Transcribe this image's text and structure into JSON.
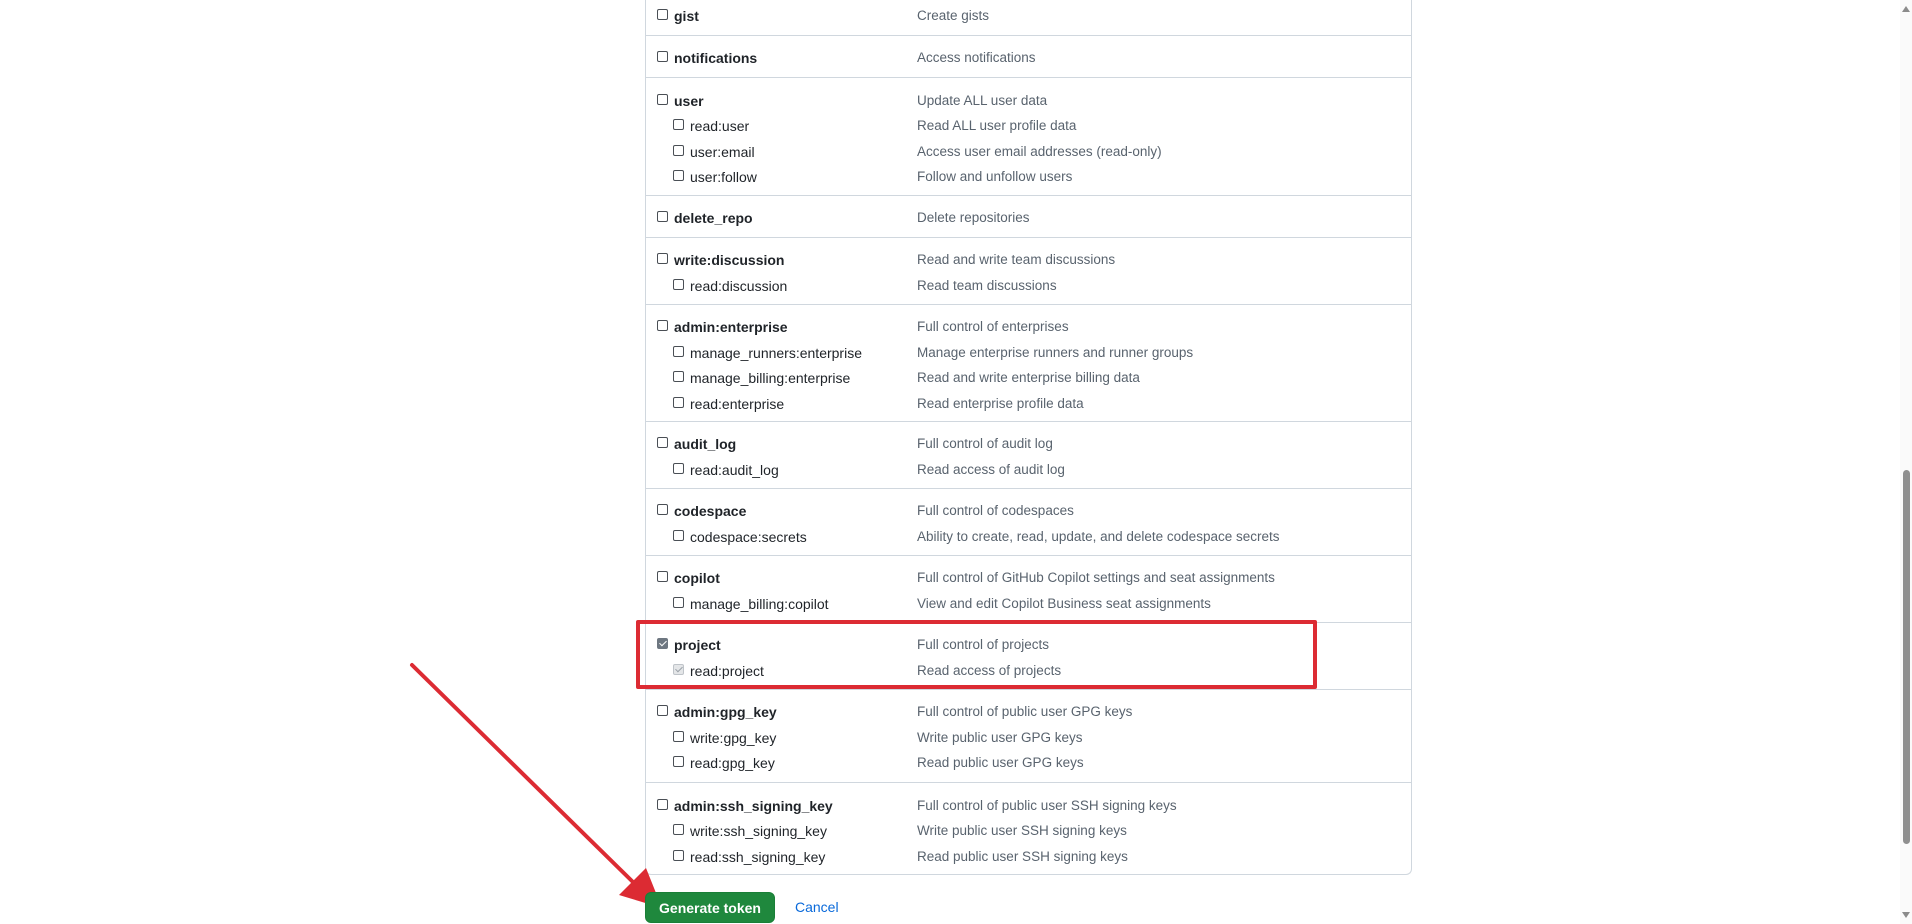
{
  "scopes": [
    {
      "items": [
        {
          "name": "gist",
          "desc": "Create gists",
          "checked": false
        }
      ]
    },
    {
      "items": [
        {
          "name": "notifications",
          "desc": "Access notifications",
          "checked": false
        }
      ]
    },
    {
      "items": [
        {
          "name": "user",
          "desc": "Update ALL user data",
          "checked": false
        },
        {
          "name": "read:user",
          "desc": "Read ALL user profile data",
          "checked": false
        },
        {
          "name": "user:email",
          "desc": "Access user email addresses (read-only)",
          "checked": false
        },
        {
          "name": "user:follow",
          "desc": "Follow and unfollow users",
          "checked": false
        }
      ]
    },
    {
      "items": [
        {
          "name": "delete_repo",
          "desc": "Delete repositories",
          "checked": false
        }
      ]
    },
    {
      "items": [
        {
          "name": "write:discussion",
          "desc": "Read and write team discussions",
          "checked": false
        },
        {
          "name": "read:discussion",
          "desc": "Read team discussions",
          "checked": false
        }
      ]
    },
    {
      "items": [
        {
          "name": "admin:enterprise",
          "desc": "Full control of enterprises",
          "checked": false
        },
        {
          "name": "manage_runners:enterprise",
          "desc": "Manage enterprise runners and runner groups",
          "checked": false
        },
        {
          "name": "manage_billing:enterprise",
          "desc": "Read and write enterprise billing data",
          "checked": false
        },
        {
          "name": "read:enterprise",
          "desc": "Read enterprise profile data",
          "checked": false
        }
      ]
    },
    {
      "items": [
        {
          "name": "audit_log",
          "desc": "Full control of audit log",
          "checked": false
        },
        {
          "name": "read:audit_log",
          "desc": "Read access of audit log",
          "checked": false
        }
      ]
    },
    {
      "items": [
        {
          "name": "codespace",
          "desc": "Full control of codespaces",
          "checked": false
        },
        {
          "name": "codespace:secrets",
          "desc": "Ability to create, read, update, and delete codespace secrets",
          "checked": false
        }
      ]
    },
    {
      "items": [
        {
          "name": "copilot",
          "desc": "Full control of GitHub Copilot settings and seat assignments",
          "checked": false
        },
        {
          "name": "manage_billing:copilot",
          "desc": "View and edit Copilot Business seat assignments",
          "checked": false
        }
      ]
    },
    {
      "items": [
        {
          "name": "project",
          "desc": "Full control of projects",
          "checked": true
        },
        {
          "name": "read:project",
          "desc": "Read access of projects",
          "checked": "inherited"
        }
      ]
    },
    {
      "items": [
        {
          "name": "admin:gpg_key",
          "desc": "Full control of public user GPG keys",
          "checked": false
        },
        {
          "name": "write:gpg_key",
          "desc": "Write public user GPG keys",
          "checked": false
        },
        {
          "name": "read:gpg_key",
          "desc": "Read public user GPG keys",
          "checked": false
        }
      ]
    },
    {
      "items": [
        {
          "name": "admin:ssh_signing_key",
          "desc": "Full control of public user SSH signing keys",
          "checked": false
        },
        {
          "name": "write:ssh_signing_key",
          "desc": "Write public user SSH signing keys",
          "checked": false
        },
        {
          "name": "read:ssh_signing_key",
          "desc": "Read public user SSH signing keys",
          "checked": false
        }
      ]
    }
  ],
  "actions": {
    "generate_label": "Generate token",
    "cancel_label": "Cancel"
  },
  "colors": {
    "primary_button": "#1f883d",
    "link": "#0969da",
    "annotation": "#dc2b33"
  }
}
